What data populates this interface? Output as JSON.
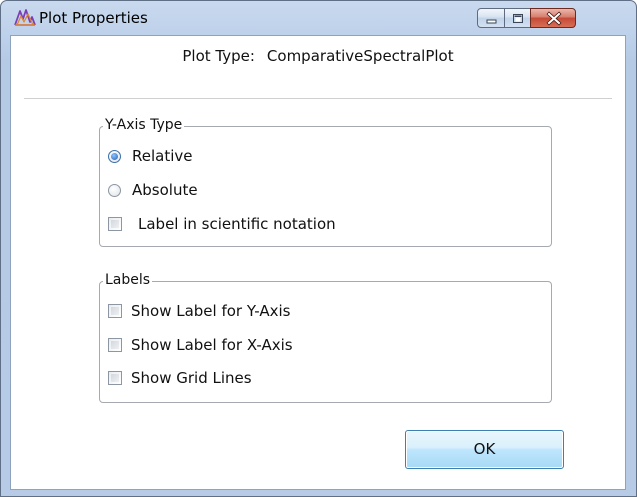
{
  "window": {
    "title": "Plot Properties",
    "app_icon": "spectrum-plot-icon",
    "caption_buttons": [
      "minimize-icon",
      "maximize-icon",
      "close-icon"
    ],
    "colors": {
      "title_bar": "#bcd0ea",
      "close_button": "#c44a36",
      "ok_button_border": "#3c7fb1"
    }
  },
  "plot_type": {
    "label": "Plot Type:",
    "value": "ComparativeSpectralPlot"
  },
  "y_axis_group": {
    "title": "Y-Axis Type",
    "relative": {
      "label": "Relative",
      "checked": true
    },
    "absolute": {
      "label": "Absolute",
      "checked": false
    },
    "scientific": {
      "label": "Label in scientific notation",
      "checked": false
    }
  },
  "labels_group": {
    "title": "Labels",
    "show_y_label": {
      "label": "Show Label for Y-Axis",
      "checked": false
    },
    "show_x_label": {
      "label": "Show Label for X-Axis",
      "checked": false
    },
    "show_grid": {
      "label": "Show Grid Lines",
      "checked": false
    }
  },
  "ok_button": {
    "label": "OK"
  }
}
